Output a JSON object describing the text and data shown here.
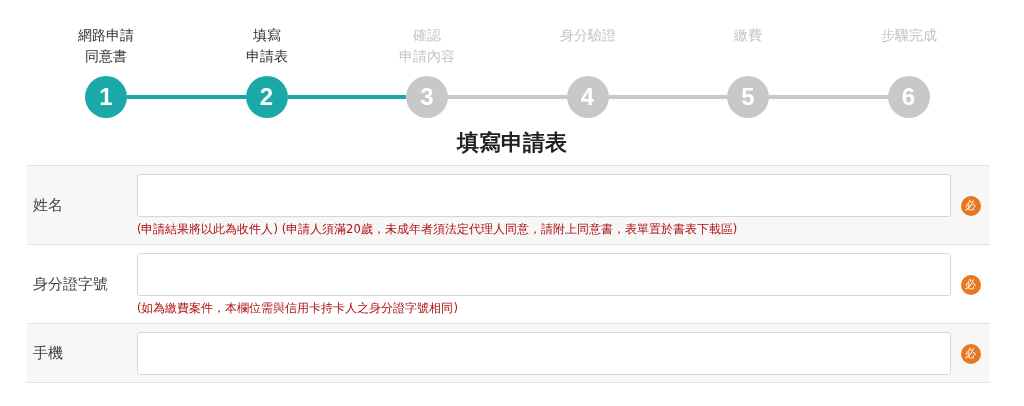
{
  "steps": [
    {
      "number": "1",
      "label_lines": [
        "網路申請",
        "同意書"
      ],
      "reached": true
    },
    {
      "number": "2",
      "label_lines": [
        "填寫",
        "申請表"
      ],
      "reached": true
    },
    {
      "number": "3",
      "label_lines": [
        "確認",
        "申請內容"
      ],
      "reached": false
    },
    {
      "number": "4",
      "label_lines": [
        "身分驗證"
      ],
      "reached": false
    },
    {
      "number": "5",
      "label_lines": [
        "繳費"
      ],
      "reached": false
    },
    {
      "number": "6",
      "label_lines": [
        "步驟完成"
      ],
      "reached": false
    }
  ],
  "form_title": "填寫申請表",
  "fields": [
    {
      "label": "姓名",
      "hint": "(申請結果將以此為收件人) (申請人須滿20歲，未成年者須法定代理人同意，請附上同意書，表單置於書表下載區)",
      "required_mark": "必"
    },
    {
      "label": "身分證字號",
      "hint": "(如為繳費案件，本欄位需與信用卡持卡人之身分證字號相同)",
      "required_mark": "必"
    },
    {
      "label": "手機",
      "required_mark": "必"
    }
  ]
}
